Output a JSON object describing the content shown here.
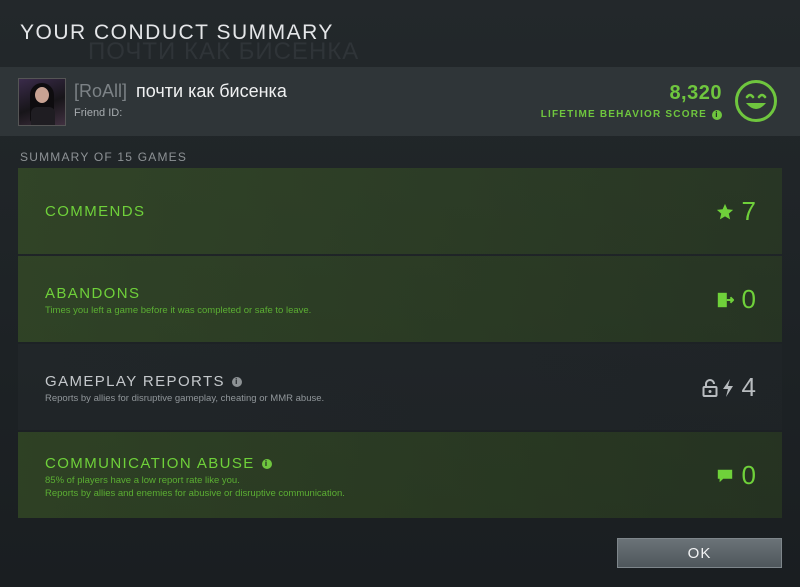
{
  "dialog": {
    "title": "YOUR CONDUCT SUMMARY",
    "background_title": "ПОЧТИ КАК БИСЕНКА"
  },
  "player": {
    "clan_tag": "[RoAll]",
    "name": "почти как бисенка",
    "friend_id_label": "Friend ID:"
  },
  "behavior": {
    "score": "8,320",
    "label": "LIFETIME BEHAVIOR SCORE",
    "face_icon": "smiley-face-icon",
    "accent_color": "#6fc63e"
  },
  "summary": {
    "header": "SUMMARY OF 15 GAMES"
  },
  "rows": [
    {
      "title": "COMMENDS",
      "description": "",
      "count": "7",
      "icon": "star-icon",
      "status": "good"
    },
    {
      "title": "ABANDONS",
      "description": "Times you left a game before it was completed or safe to leave.",
      "count": "0",
      "icon": "exit-door-icon",
      "status": "good"
    },
    {
      "title": "GAMEPLAY REPORTS",
      "description": "Reports by allies for disruptive gameplay, cheating or MMR abuse.",
      "count": "4",
      "icons": [
        "lock-icon",
        "lightning-icon"
      ],
      "status": "neutral"
    },
    {
      "title": "COMMUNICATION ABUSE",
      "description_line1": "85% of players have a low report rate like you.",
      "description_line2": "Reports by allies and enemies for abusive or disruptive communication.",
      "count": "0",
      "icon": "chat-bubble-icon",
      "status": "good"
    }
  ],
  "ok_button": {
    "label": "OK"
  }
}
